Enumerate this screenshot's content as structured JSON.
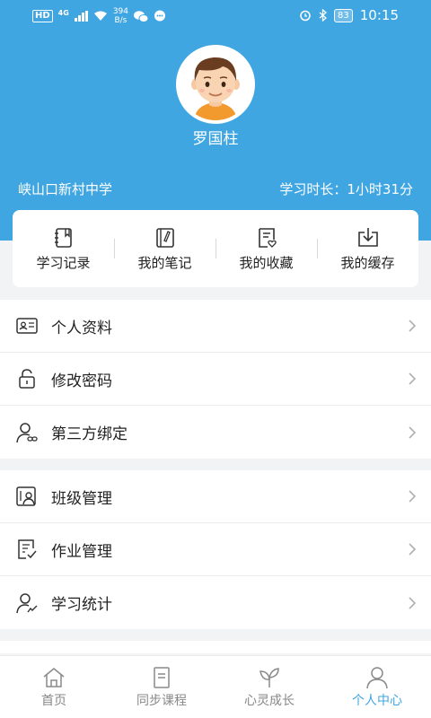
{
  "status_bar": {
    "hd": "HD",
    "network": "4G",
    "speed_value": "394",
    "speed_unit": "B/s",
    "battery": "83",
    "time": "10:15"
  },
  "profile": {
    "name": "罗国柱",
    "school": "峡山口新村中学",
    "study_time": "学习时长：1小时31分"
  },
  "quick_actions": [
    {
      "label": "学习记录",
      "icon": "study-record-icon"
    },
    {
      "label": "我的笔记",
      "icon": "notes-icon"
    },
    {
      "label": "我的收藏",
      "icon": "favorites-icon"
    },
    {
      "label": "我的缓存",
      "icon": "download-icon"
    }
  ],
  "menu": {
    "personal_info": "个人资料",
    "change_password": "修改密码",
    "third_party": "第三方绑定",
    "class_manage": "班级管理",
    "homework_manage": "作业管理",
    "study_stats": "学习统计"
  },
  "tabs": [
    {
      "label": "首页",
      "icon": "home-icon"
    },
    {
      "label": "同步课程",
      "icon": "course-icon"
    },
    {
      "label": "心灵成长",
      "icon": "leaf-icon"
    },
    {
      "label": "个人中心",
      "icon": "person-icon",
      "active": true
    }
  ],
  "colors": {
    "accent": "#40a6e2",
    "background": "#f2f3f5"
  }
}
